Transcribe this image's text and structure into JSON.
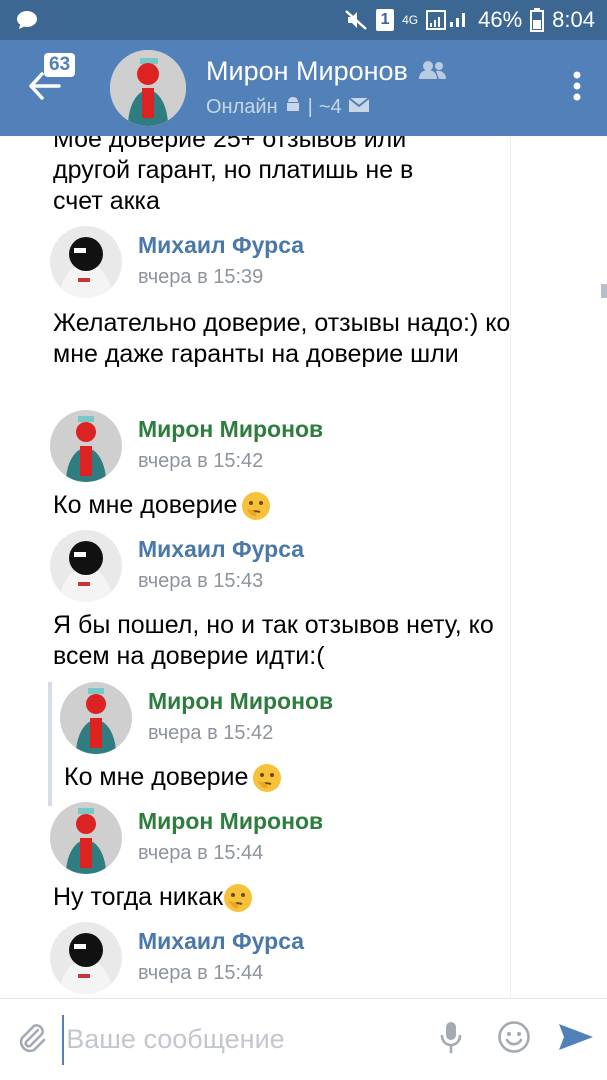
{
  "status_bar": {
    "network": "4G",
    "battery": "46%",
    "time": "8:04",
    "sim_label": "1"
  },
  "header": {
    "unread_count": "63",
    "name": "Мирон Миронов",
    "status_online": "Онлайн",
    "status_sep": "|",
    "status_count": "~4"
  },
  "messages": [
    {
      "type": "text",
      "text_line1": "Мое доверие 25+ отзывов или",
      "text_line2": "другой гарант, но платишь не в",
      "text_line3": "счет акка"
    },
    {
      "type": "head",
      "author": "Михаил Фурса",
      "time": "вчера в 15:39"
    },
    {
      "type": "text",
      "text": "Желательно доверие, отзывы надо:) ко мне даже гаранты на доверие шли"
    },
    {
      "type": "head",
      "author": "Мирон Миронов",
      "time": "вчера в 15:42"
    },
    {
      "type": "text",
      "text": "Ко мне доверие"
    },
    {
      "type": "head",
      "author": "Михаил Фурса",
      "time": "вчера в 15:43"
    },
    {
      "type": "text",
      "text": "Я бы пошел, но и так отзывов нету, ко всем на доверие идти:("
    },
    {
      "type": "quote_head",
      "author": "Мирон Миронов",
      "time": "вчера в 15:42"
    },
    {
      "type": "quote_text",
      "text": "Ко мне доверие"
    },
    {
      "type": "head",
      "author": "Мирон Миронов",
      "time": "вчера в 15:44"
    },
    {
      "type": "text",
      "text": "Ну тогда никак"
    },
    {
      "type": "head",
      "author": "Михаил Фурса",
      "time": "вчера в 15:44"
    }
  ],
  "input": {
    "placeholder": "Ваше сообщение"
  },
  "icons": {
    "chat": "chat-bubble-icon",
    "attach": "paperclip-icon",
    "mic": "microphone-icon",
    "emoji": "smiley-icon",
    "send": "send-icon"
  },
  "colors": {
    "header_bg": "#5181b8",
    "statusbar_bg": "#3d6793",
    "author_blue": "#4a78a8",
    "author_green": "#2e7d3e",
    "accent": "#5181b8"
  }
}
